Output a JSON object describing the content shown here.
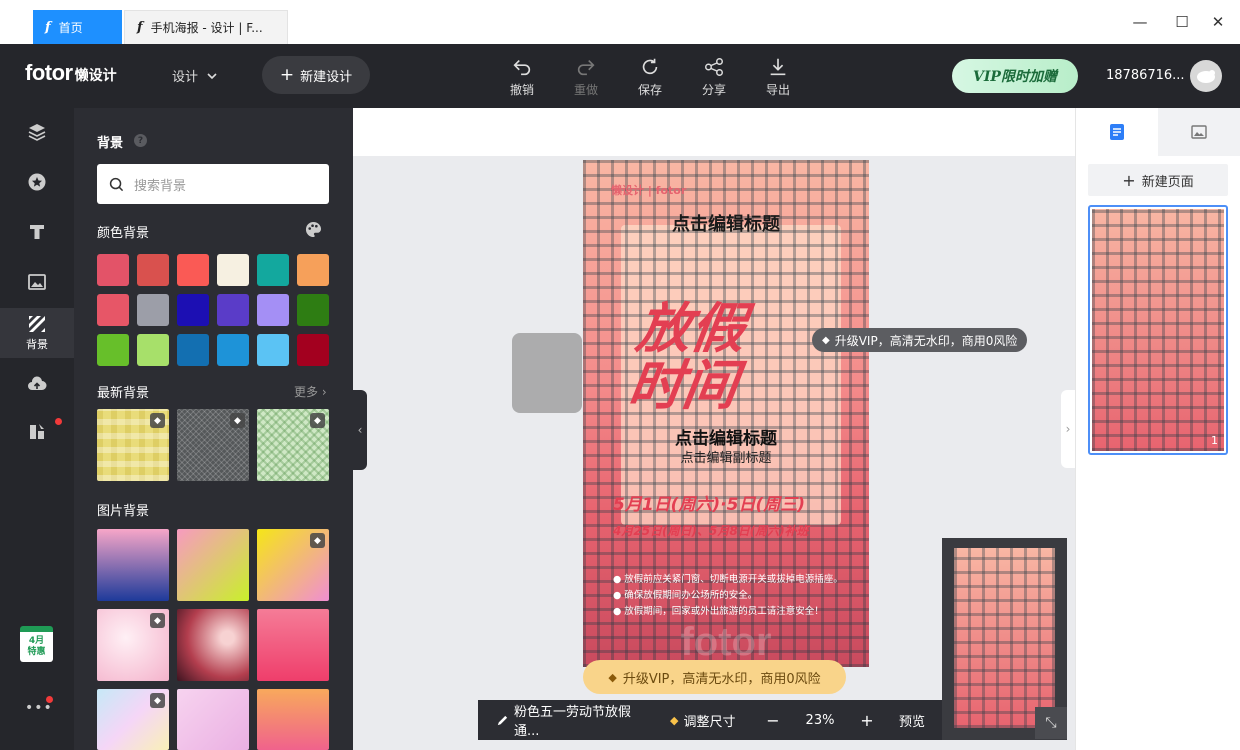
{
  "browser": {
    "tabs": [
      {
        "icon": "f",
        "label": "首页"
      },
      {
        "icon": "f",
        "label": "手机海报 - 设计 | F..."
      }
    ],
    "controls": {
      "minimize": "—",
      "maximize": "☐",
      "close": "✕"
    }
  },
  "header": {
    "logo_brand": "fotor",
    "logo_sub": "懒设计",
    "design_menu": "设计",
    "new_design": "新建设计",
    "tools": [
      {
        "label": "撤销",
        "icon": "undo-icon"
      },
      {
        "label": "重做",
        "icon": "redo-icon"
      },
      {
        "label": "保存",
        "icon": "save-icon"
      },
      {
        "label": "分享",
        "icon": "share-icon"
      },
      {
        "label": "导出",
        "icon": "export-icon"
      }
    ],
    "vip_button": "VIP限时加赠",
    "user_phone": "18786716..."
  },
  "left_rail": {
    "active_label": "背景",
    "calendar_badge": {
      "month": "4月",
      "text": "特惠"
    },
    "more": "•••"
  },
  "panel": {
    "title": "背景",
    "search_placeholder": "搜索背景",
    "color_section": "颜色背景",
    "colors": [
      "#e35368",
      "#d9514e",
      "#fa5a55",
      "#f6f0e1",
      "#13a89e",
      "#f6a05a",
      "#e75667",
      "#9c9ea8",
      "#1c0fb3",
      "#5a3cc8",
      "#a48ff5",
      "#2e7d13",
      "#67bf2a",
      "#a7e06a",
      "#136fb1",
      "#1e93d8",
      "#5bc3f4",
      "#a3001f"
    ],
    "latest_section": "最新背景",
    "more_label": "更多",
    "image_section": "图片背景"
  },
  "canvas": {
    "poster": {
      "brand": "懒设计 | fotor",
      "title": "点击编辑标题",
      "big_line1": "放假",
      "big_line2": "时间",
      "subtitle": "点击编辑标题",
      "subtitle2": "点击编辑副标题",
      "date_main": "5月1日(周六)·5日(周三)",
      "date_sub": "4月25日(周日)、5月8日(周六)补班",
      "bullets": [
        "● 放假前应关紧门窗、切断电源开关或拔掉电源插座。",
        "● 确保放假期间办公场所的安全。",
        "● 放假期间，回家或外出旅游的员工请注意安全！"
      ],
      "watermark": "fotor"
    },
    "vip_tip": "升级VIP，高清无水印，商用0风险",
    "vip_banner": "升级VIP，高清无水印，商用0风险"
  },
  "bottom_bar": {
    "file_name": "粉色五一劳动节放假通...",
    "resize": "调整尺寸",
    "minus": "−",
    "zoom": "23%",
    "plus": "+",
    "preview": "预览"
  },
  "right_panel": {
    "new_page": "新建页面",
    "page_number": "1"
  }
}
